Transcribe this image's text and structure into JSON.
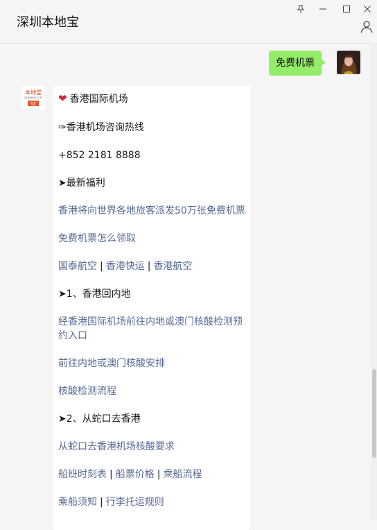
{
  "window": {
    "title": "深圳本地宝"
  },
  "outgoing": {
    "text": "免费机票"
  },
  "bot_logo": {
    "line1": "本地宝",
    "line2": "BENDIBAO.COM",
    "badge": "SZ"
  },
  "card": {
    "airport_title": "香港国际机场",
    "hotline_label": "✑香港机场咨询热线",
    "phone": "+852 2181 8888",
    "section_welfare": "➤最新福利",
    "link_free_tickets": "香港将向世界各地旅客派发50万张免费机票",
    "link_how_to_get": "免费机票怎么领取",
    "airlines": [
      "国泰航空",
      "香港快运",
      "香港航空"
    ],
    "section_hk_to_mainland": "➤1、香港回内地",
    "link_test_booking_line1": "经香港国际机场前往内地或澳门核酸检测预",
    "link_test_booking_line2": "约入口",
    "link_test_arrangement": "前往内地或澳门核酸安排",
    "link_test_process": "核酸检测流程",
    "section_shekou_to_hk": "➤2、从蛇口去香港",
    "link_shekou_requirement": "从蛇口去香港机场核酸要求",
    "ferry_links": [
      "船班时刻表",
      "船票价格",
      "乘船流程"
    ],
    "notice_links": [
      "乘船须知",
      "行李托运规则"
    ]
  },
  "colors": {
    "link": "#576b95",
    "bubble_out": "#95ec69",
    "background": "#f5f5f5"
  }
}
